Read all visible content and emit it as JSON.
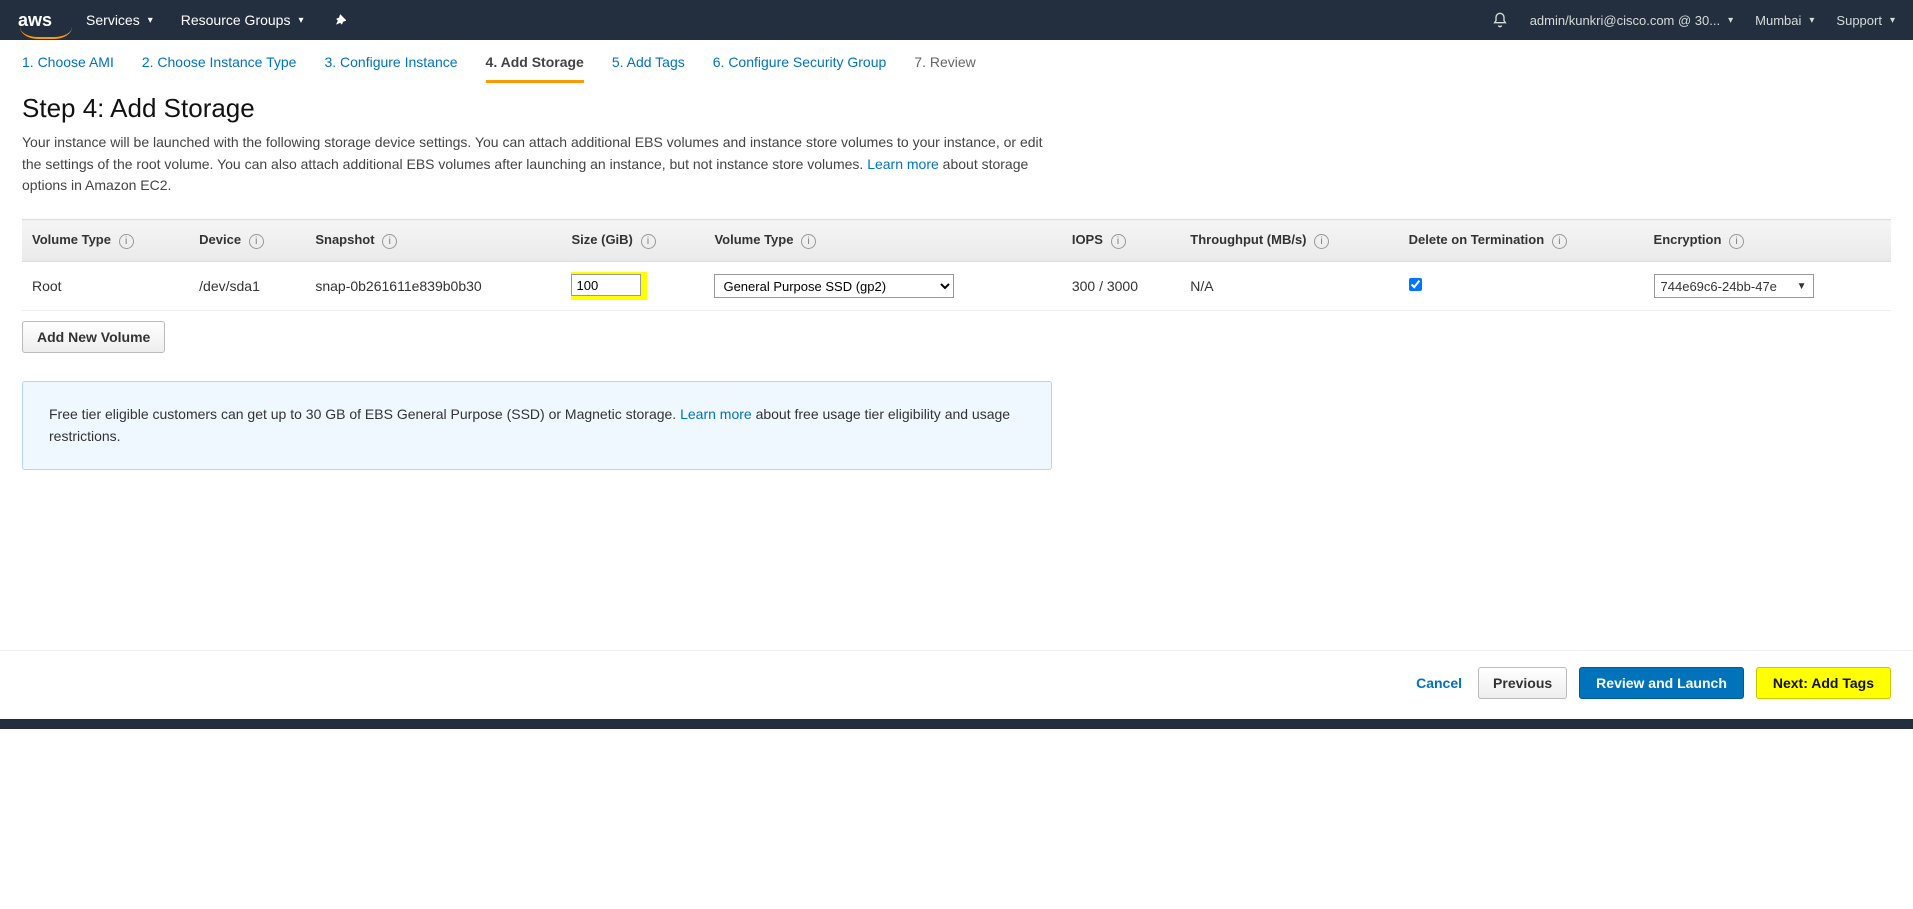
{
  "nav": {
    "logo": "aws",
    "services": "Services",
    "resource_groups": "Resource Groups",
    "account": "admin/kunkri@cisco.com @ 30...",
    "region": "Mumbai",
    "support": "Support"
  },
  "tabs": [
    {
      "label": "1. Choose AMI",
      "active": false
    },
    {
      "label": "2. Choose Instance Type",
      "active": false
    },
    {
      "label": "3. Configure Instance",
      "active": false
    },
    {
      "label": "4. Add Storage",
      "active": true
    },
    {
      "label": "5. Add Tags",
      "active": false
    },
    {
      "label": "6. Configure Security Group",
      "active": false
    },
    {
      "label": "7. Review",
      "active": false
    }
  ],
  "step": {
    "title": "Step 4: Add Storage",
    "desc_part1": "Your instance will be launched with the following storage device settings. You can attach additional EBS volumes and instance store volumes to your instance, or edit the settings of the root volume. You can also attach additional EBS volumes after launching an instance, but not instance store volumes. ",
    "learn_more": "Learn more",
    "desc_part2": " about storage options in Amazon EC2."
  },
  "table": {
    "headers": {
      "vol_type": "Volume Type",
      "device": "Device",
      "snapshot": "Snapshot",
      "size": "Size (GiB)",
      "vol_type2": "Volume Type",
      "iops": "IOPS",
      "throughput": "Throughput (MB/s)",
      "delete": "Delete on Termination",
      "encryption": "Encryption"
    },
    "row": {
      "vol_type": "Root",
      "device": "/dev/sda1",
      "snapshot": "snap-0b261611e839b0b30",
      "size": "100",
      "vol_type2_options": [
        "General Purpose SSD (gp2)"
      ],
      "vol_type2_selected": "General Purpose SSD (gp2)",
      "iops": "300 / 3000",
      "throughput": "N/A",
      "delete_checked": true,
      "encryption": "744e69c6-24bb-47e"
    }
  },
  "buttons": {
    "add_volume": "Add New Volume",
    "cancel": "Cancel",
    "previous": "Previous",
    "review": "Review and Launch",
    "next": "Next: Add Tags"
  },
  "info_box": {
    "text1": "Free tier eligible customers can get up to 30 GB of EBS General Purpose (SSD) or Magnetic storage. ",
    "learn_more": "Learn more",
    "text2": " about free usage tier eligibility and usage restrictions."
  }
}
